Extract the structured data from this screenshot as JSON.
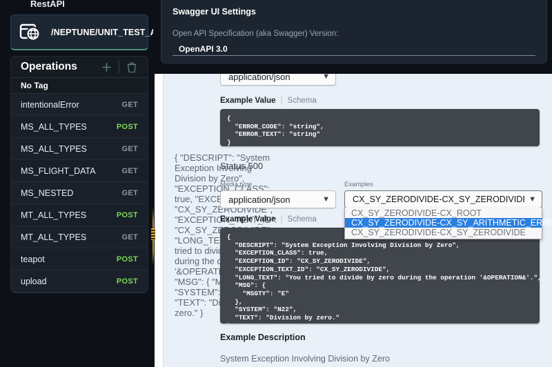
{
  "sidebar": {
    "brand": "RestAPI",
    "api": {
      "name": "/NEPTUNE/UNIT_TEST_API",
      "icon": "api-globe-icon"
    },
    "operations": {
      "title": "Operations",
      "add_icon": "plus-icon",
      "delete_icon": "trash-icon",
      "tag_label": "No Tag",
      "items": [
        {
          "name": "intentionalError",
          "verb": "GET"
        },
        {
          "name": "MS_ALL_TYPES",
          "verb": "POST"
        },
        {
          "name": "MS_ALL_TYPES",
          "verb": "GET"
        },
        {
          "name": "MS_FLIGHT_DATA",
          "verb": "GET"
        },
        {
          "name": "MS_NESTED",
          "verb": "GET"
        },
        {
          "name": "MT_ALL_TYPES",
          "verb": "POST"
        },
        {
          "name": "MT_ALL_TYPES",
          "verb": "GET"
        },
        {
          "name": "teapot",
          "verb": "POST"
        },
        {
          "name": "upload",
          "verb": "POST"
        }
      ]
    },
    "splitter": {
      "name": "sidebar-resize-handle"
    }
  },
  "settings": {
    "title": "Swagger UI Settings",
    "spec_version_label": "Open API Specification (aka Swagger) Version:",
    "spec_version_value": "OpenAPI 3.0"
  },
  "response_top": {
    "media_type_value": "application/json",
    "example_value_label": "Example Value",
    "schema_label": "Schema",
    "code": "{\n  \"ERROR_CODE\": \"string\",\n  \"ERROR_TEXT\": \"string\"\n}"
  },
  "response_500": {
    "code": "{\n  \"DESCRIPT\": \"System Exception Involving Division by Zero\",\n  \"EXCEPTION_CLASS\": true,\n  \"EXCEPTION_ID\": \"CX_SY_ZERODIVIDE\",\n  \"EXCEPTION_TEXT_ID\": \"CX_SY_ZERODIVIDE\",\n  \"LONG_TEXT\": \"You tried to divide by zero during the operation '&OPERATION&'.\",\n  \"MSG\": {\n    \"MSGTY\": \"E\"\n  },\n  \"SYSTEM\": \"N22\",\n  \"TEXT\": \"Division by zero.\"\n}",
    "status_text": "Status 500",
    "media_type_label": "Media type",
    "media_type_value": "application/json",
    "examples_label": "Examples",
    "examples_value": "CX_SY_ZERODIVIDE-CX_SY_ZERODIVIDE",
    "examples_options": [
      {
        "label": "CX_SY_ZERODIVIDE-CX_ROOT",
        "selected": false
      },
      {
        "label": "CX_SY_ZERODIVIDE-CX_SY_ARITHMETIC_ERROR",
        "selected": true
      },
      {
        "label": "CX_SY_ZERODIVIDE-CX_SY_ZERODIVIDE",
        "selected": false
      }
    ],
    "example_value_label": "Example Value",
    "schema_label": "Schema",
    "description_title": "Example Description",
    "description_text": "System Exception Involving Division by Zero"
  },
  "colors": {
    "accent_green": "#7ed957",
    "splitter": "#e2a33c",
    "select_highlight": "#2a7fe0",
    "code_bg": "#41454c",
    "content_bg": "#eaf0f8"
  }
}
